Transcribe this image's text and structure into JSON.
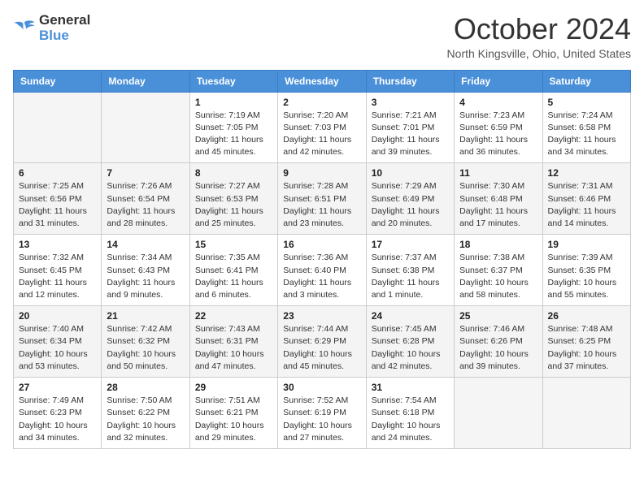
{
  "header": {
    "logo_line1": "General",
    "logo_line2": "Blue",
    "month_title": "October 2024",
    "location": "North Kingsville, Ohio, United States"
  },
  "days_of_week": [
    "Sunday",
    "Monday",
    "Tuesday",
    "Wednesday",
    "Thursday",
    "Friday",
    "Saturday"
  ],
  "weeks": [
    [
      {
        "day": "",
        "info": ""
      },
      {
        "day": "",
        "info": ""
      },
      {
        "day": "1",
        "info": "Sunrise: 7:19 AM\nSunset: 7:05 PM\nDaylight: 11 hours and 45 minutes."
      },
      {
        "day": "2",
        "info": "Sunrise: 7:20 AM\nSunset: 7:03 PM\nDaylight: 11 hours and 42 minutes."
      },
      {
        "day": "3",
        "info": "Sunrise: 7:21 AM\nSunset: 7:01 PM\nDaylight: 11 hours and 39 minutes."
      },
      {
        "day": "4",
        "info": "Sunrise: 7:23 AM\nSunset: 6:59 PM\nDaylight: 11 hours and 36 minutes."
      },
      {
        "day": "5",
        "info": "Sunrise: 7:24 AM\nSunset: 6:58 PM\nDaylight: 11 hours and 34 minutes."
      }
    ],
    [
      {
        "day": "6",
        "info": "Sunrise: 7:25 AM\nSunset: 6:56 PM\nDaylight: 11 hours and 31 minutes."
      },
      {
        "day": "7",
        "info": "Sunrise: 7:26 AM\nSunset: 6:54 PM\nDaylight: 11 hours and 28 minutes."
      },
      {
        "day": "8",
        "info": "Sunrise: 7:27 AM\nSunset: 6:53 PM\nDaylight: 11 hours and 25 minutes."
      },
      {
        "day": "9",
        "info": "Sunrise: 7:28 AM\nSunset: 6:51 PM\nDaylight: 11 hours and 23 minutes."
      },
      {
        "day": "10",
        "info": "Sunrise: 7:29 AM\nSunset: 6:49 PM\nDaylight: 11 hours and 20 minutes."
      },
      {
        "day": "11",
        "info": "Sunrise: 7:30 AM\nSunset: 6:48 PM\nDaylight: 11 hours and 17 minutes."
      },
      {
        "day": "12",
        "info": "Sunrise: 7:31 AM\nSunset: 6:46 PM\nDaylight: 11 hours and 14 minutes."
      }
    ],
    [
      {
        "day": "13",
        "info": "Sunrise: 7:32 AM\nSunset: 6:45 PM\nDaylight: 11 hours and 12 minutes."
      },
      {
        "day": "14",
        "info": "Sunrise: 7:34 AM\nSunset: 6:43 PM\nDaylight: 11 hours and 9 minutes."
      },
      {
        "day": "15",
        "info": "Sunrise: 7:35 AM\nSunset: 6:41 PM\nDaylight: 11 hours and 6 minutes."
      },
      {
        "day": "16",
        "info": "Sunrise: 7:36 AM\nSunset: 6:40 PM\nDaylight: 11 hours and 3 minutes."
      },
      {
        "day": "17",
        "info": "Sunrise: 7:37 AM\nSunset: 6:38 PM\nDaylight: 11 hours and 1 minute."
      },
      {
        "day": "18",
        "info": "Sunrise: 7:38 AM\nSunset: 6:37 PM\nDaylight: 10 hours and 58 minutes."
      },
      {
        "day": "19",
        "info": "Sunrise: 7:39 AM\nSunset: 6:35 PM\nDaylight: 10 hours and 55 minutes."
      }
    ],
    [
      {
        "day": "20",
        "info": "Sunrise: 7:40 AM\nSunset: 6:34 PM\nDaylight: 10 hours and 53 minutes."
      },
      {
        "day": "21",
        "info": "Sunrise: 7:42 AM\nSunset: 6:32 PM\nDaylight: 10 hours and 50 minutes."
      },
      {
        "day": "22",
        "info": "Sunrise: 7:43 AM\nSunset: 6:31 PM\nDaylight: 10 hours and 47 minutes."
      },
      {
        "day": "23",
        "info": "Sunrise: 7:44 AM\nSunset: 6:29 PM\nDaylight: 10 hours and 45 minutes."
      },
      {
        "day": "24",
        "info": "Sunrise: 7:45 AM\nSunset: 6:28 PM\nDaylight: 10 hours and 42 minutes."
      },
      {
        "day": "25",
        "info": "Sunrise: 7:46 AM\nSunset: 6:26 PM\nDaylight: 10 hours and 39 minutes."
      },
      {
        "day": "26",
        "info": "Sunrise: 7:48 AM\nSunset: 6:25 PM\nDaylight: 10 hours and 37 minutes."
      }
    ],
    [
      {
        "day": "27",
        "info": "Sunrise: 7:49 AM\nSunset: 6:23 PM\nDaylight: 10 hours and 34 minutes."
      },
      {
        "day": "28",
        "info": "Sunrise: 7:50 AM\nSunset: 6:22 PM\nDaylight: 10 hours and 32 minutes."
      },
      {
        "day": "29",
        "info": "Sunrise: 7:51 AM\nSunset: 6:21 PM\nDaylight: 10 hours and 29 minutes."
      },
      {
        "day": "30",
        "info": "Sunrise: 7:52 AM\nSunset: 6:19 PM\nDaylight: 10 hours and 27 minutes."
      },
      {
        "day": "31",
        "info": "Sunrise: 7:54 AM\nSunset: 6:18 PM\nDaylight: 10 hours and 24 minutes."
      },
      {
        "day": "",
        "info": ""
      },
      {
        "day": "",
        "info": ""
      }
    ]
  ]
}
